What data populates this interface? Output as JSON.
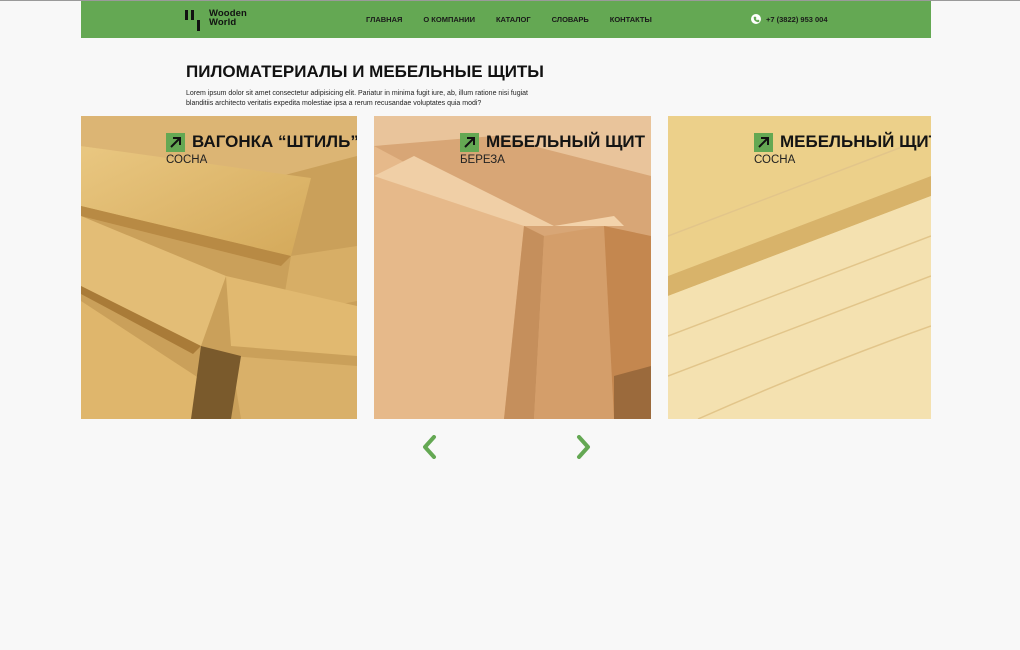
{
  "brand": {
    "line1": "Wooden",
    "line2": "World"
  },
  "nav": [
    {
      "label": "ГЛАВНАЯ"
    },
    {
      "label": "О КОМПАНИИ"
    },
    {
      "label": "КАТАЛОГ"
    },
    {
      "label": "СЛОВАРЬ"
    },
    {
      "label": "КОНТАКТЫ"
    }
  ],
  "contact": {
    "phone": "+7 (3822) 953 004",
    "icon": "phone-icon"
  },
  "main": {
    "title": "ПИЛОМАТЕРИАЛЫ И МЕБЕЛЬНЫЕ ЩИТЫ",
    "intro": "Lorem ipsum dolor sit amet consectetur adipisicing elit. Pariatur in minima fugit iure, ab, illum ratione nisi fugiat blanditiis architecto veritatis expedita molestiae ipsa a rerum recusandae voluptates quia modi?"
  },
  "products": [
    {
      "name": "ВАГОНКА “ШТИЛЬ”",
      "subtitle": "СОСНА",
      "icon": "arrow-up-right-icon"
    },
    {
      "name": "МЕБЕЛЬНЫЙ ЩИТ",
      "subtitle": "БЕРЕЗА",
      "icon": "arrow-up-right-icon"
    },
    {
      "name": "МЕБЕЛЬНЫЙ ЩИТ",
      "subtitle": "СОСНА",
      "icon": "arrow-up-right-icon"
    }
  ],
  "slider": {
    "prev_icon": "chevron-left-icon",
    "next_icon": "chevron-right-icon"
  },
  "colors": {
    "accent": "#64a853",
    "background": "#f8f8f8",
    "text": "#111111"
  }
}
